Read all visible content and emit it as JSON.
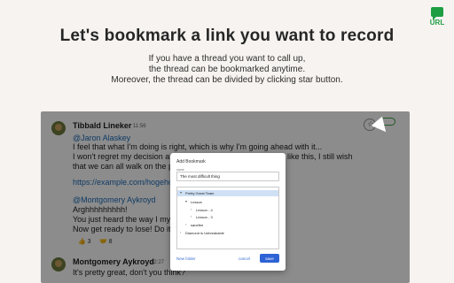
{
  "header": {
    "headline": "Let's bookmark a link you want to record",
    "lines": [
      "If you have a thread you want to call up,",
      "the thread can be bookmarked anytime.",
      "Moreover, the thread can be divided by clicking star button."
    ]
  },
  "logo": {
    "text": "URL",
    "color": "#1e9e43"
  },
  "chat": {
    "messages": [
      {
        "name": "Tibbald Lineker",
        "time": "11:56",
        "lines": [
          "@Jaron Alaskey",
          "I feel that what I'm doing is right, which is why I'm going ahead with it...",
          "I won't regret my decision at",
          "like this, I still wish",
          "that we can all walk on the pa",
          "https://example.com/hogeho",
          "@Montgomery Aykroyd",
          "Arghhhhhhhhh!",
          "You just heard the way I mys",
          "Now get ready to lose! Do it!"
        ],
        "reactions": [
          "👍 3",
          "🤝 8"
        ]
      },
      {
        "name": "Montgomery Aykroyd",
        "time": "12:27",
        "lines": [
          "It's pretty great, don't you think?"
        ]
      }
    ],
    "status_pill": "Links"
  },
  "modal": {
    "title": "Add Bookmark",
    "name_label": "name",
    "name_value": "The most difficult thing",
    "tree": [
      {
        "label": "Pretty Great Team",
        "level": 0,
        "arrow": "▾",
        "selected": true
      },
      {
        "label": "Lesson",
        "level": 1,
        "arrow": "▾",
        "selected": false
      },
      {
        "label": "Lesson - 4",
        "level": 2,
        "arrow": "›",
        "selected": false
      },
      {
        "label": "Lesson - 3",
        "level": 2,
        "arrow": "›",
        "selected": false
      },
      {
        "label": "sanefee",
        "level": 1,
        "arrow": "›",
        "selected": false
      },
      {
        "label": "Diamond is Unbreakable",
        "level": 0,
        "arrow": "›",
        "selected": false
      }
    ],
    "buttons": {
      "new_folder": "New folder",
      "cancel": "cancel",
      "save": "save"
    }
  }
}
